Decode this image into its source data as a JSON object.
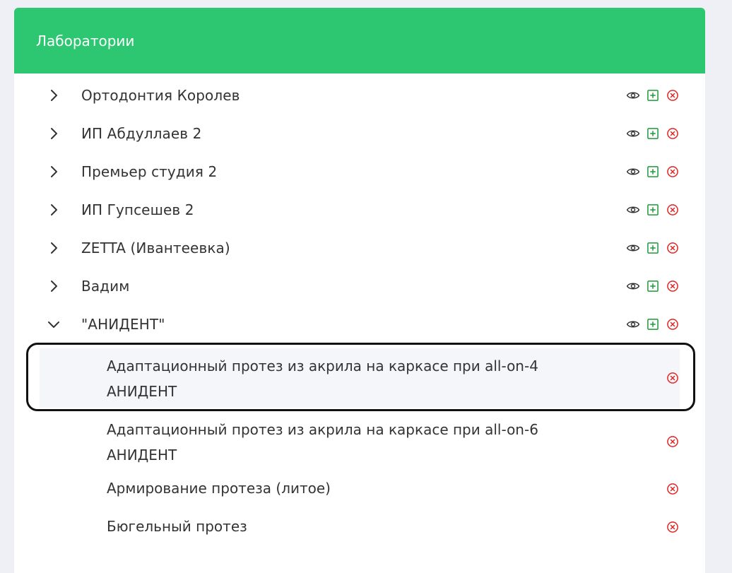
{
  "header": {
    "title": "Лаборатории"
  },
  "labs": [
    {
      "name": "Ортодонтия Королев",
      "expanded": false
    },
    {
      "name": "ИП Абдуллаев 2",
      "expanded": false
    },
    {
      "name": "Премьер студия 2",
      "expanded": false
    },
    {
      "name": "ИП Гупсешев 2",
      "expanded": false
    },
    {
      "name": "ZETTA (Ивантеевка)",
      "expanded": false
    },
    {
      "name": "Вадим",
      "expanded": false
    },
    {
      "name": "\"АНИДЕНТ\"",
      "expanded": true
    }
  ],
  "services": [
    {
      "line1": "Адаптационный протез из акрила на каркасе при all-on-4",
      "line2": "АНИДЕНТ",
      "selected": true
    },
    {
      "line1": "Адаптационный протез из акрила на каркасе при all-on-6",
      "line2": "АНИДЕНТ",
      "selected": false
    },
    {
      "line1": "Армирование протеза (литое)",
      "line2": "",
      "selected": false
    },
    {
      "line1": "Бюгельный протез",
      "line2": "",
      "selected": false
    }
  ],
  "icons": {
    "view": "eye-icon",
    "add": "plus-square-icon",
    "delete": "x-circle-icon",
    "expand": "chevron-right-icon",
    "collapse": "chevron-down-icon"
  },
  "colors": {
    "header_bg": "#2cc770",
    "add_icon": "#1a9a3a",
    "delete_icon": "#e02424",
    "text": "#333333"
  }
}
